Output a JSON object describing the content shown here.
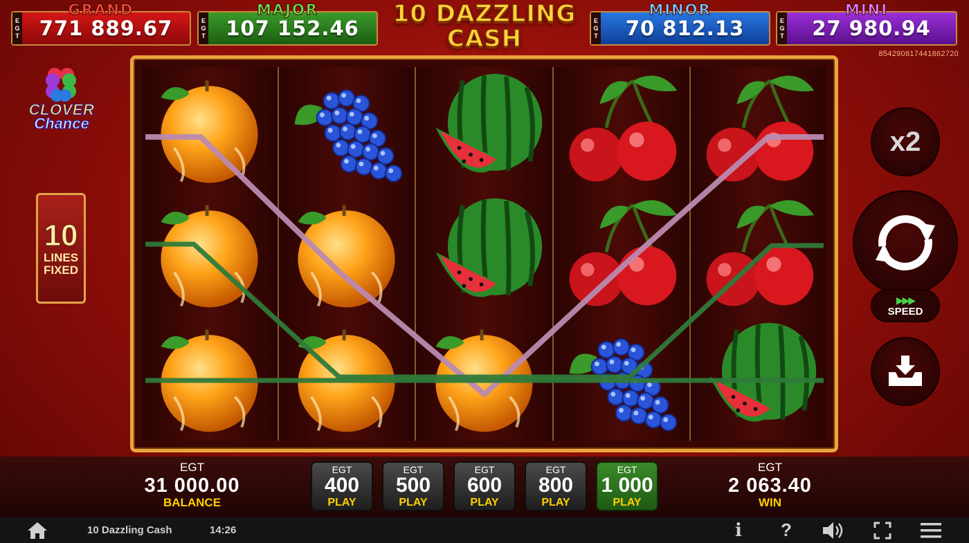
{
  "jackpots": {
    "grand": {
      "name": "GRAND",
      "value": "771 889.67",
      "currency": "EGT"
    },
    "major": {
      "name": "MAJOR",
      "value": "107 152.46",
      "currency": "EGT"
    },
    "minor": {
      "name": "MINOR",
      "value": "70 812.13",
      "currency": "EGT"
    },
    "mini": {
      "name": "MINI",
      "value": "27 980.94",
      "currency": "EGT"
    }
  },
  "game": {
    "title_line1": "10 DAZZLING",
    "title_line2": "CASH",
    "ticket_id": "854290817441862720"
  },
  "logo": {
    "line1": "CLOVER",
    "line2": "Chance"
  },
  "lines": {
    "number": "10",
    "label_line1": "LINES",
    "label_line2": "FIXED"
  },
  "reels": [
    [
      "orange",
      "orange",
      "orange"
    ],
    [
      "grapes",
      "orange",
      "orange"
    ],
    [
      "watermelon",
      "watermelon",
      "orange"
    ],
    [
      "cherry",
      "cherry",
      "grapes"
    ],
    [
      "cherry",
      "cherry",
      "watermelon"
    ]
  ],
  "paylines": {
    "colors": [
      "#b98ab0",
      "#2f7a3a",
      "#2f7a3a"
    ]
  },
  "controls": {
    "multiplier": "x2",
    "spin_icon": "spin-arrows-icon",
    "speed_label": "SPEED",
    "speed_icon": "fast-forward-icon",
    "collect_icon": "collect-tray-icon"
  },
  "balance": {
    "currency": "EGT",
    "amount": "31 000.00",
    "label": "BALANCE"
  },
  "win": {
    "currency": "EGT",
    "amount": "2 063.40",
    "label": "WIN"
  },
  "bets": [
    {
      "currency": "EGT",
      "value": "400",
      "label": "PLAY",
      "active": false
    },
    {
      "currency": "EGT",
      "value": "500",
      "label": "PLAY",
      "active": false
    },
    {
      "currency": "EGT",
      "value": "600",
      "label": "PLAY",
      "active": false
    },
    {
      "currency": "EGT",
      "value": "800",
      "label": "PLAY",
      "active": false
    },
    {
      "currency": "EGT",
      "value": "1 000",
      "label": "PLAY",
      "active": true
    }
  ],
  "footer": {
    "title": "10 Dazzling Cash",
    "time": "14:26",
    "icons": [
      "home-icon",
      "info-icon",
      "help-icon",
      "sound-icon",
      "fullscreen-icon",
      "menu-icon"
    ],
    "info_glyph": "i",
    "help_glyph": "?"
  }
}
